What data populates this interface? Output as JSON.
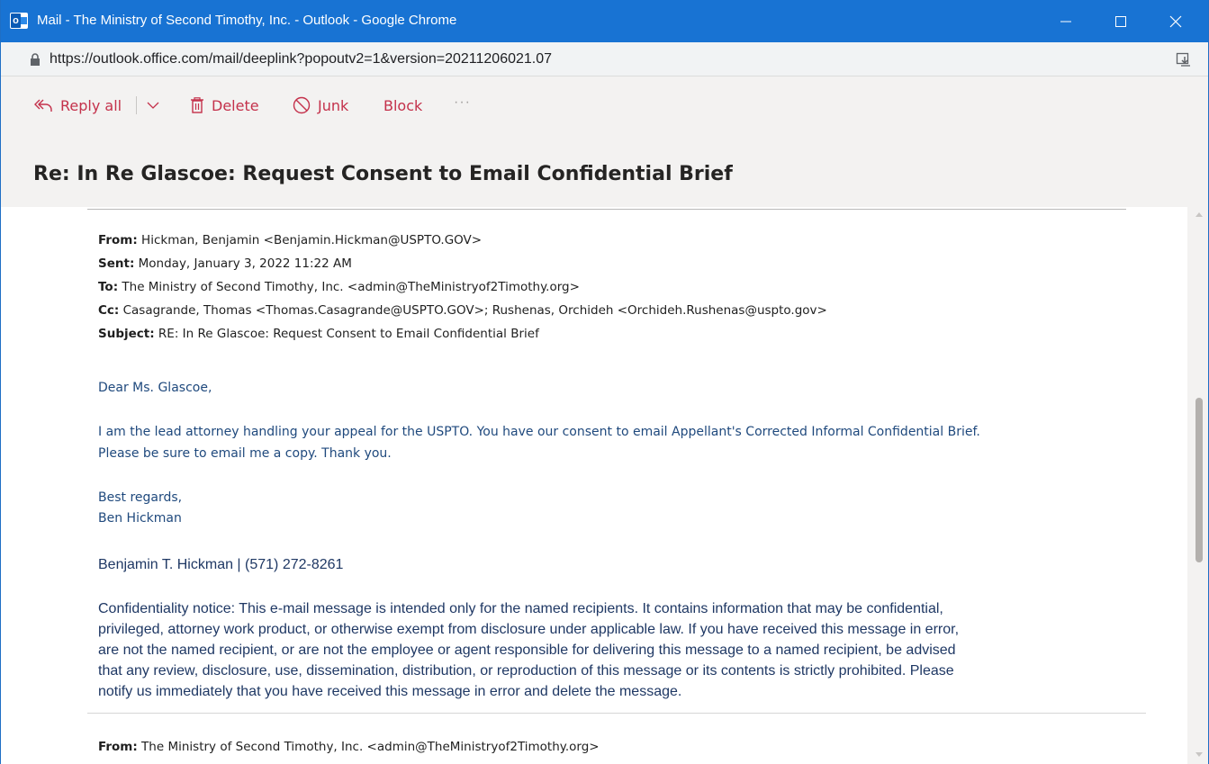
{
  "window": {
    "title": "Mail - The Ministry of Second Timothy, Inc. - Outlook - Google Chrome"
  },
  "address": {
    "url": "https://outlook.office.com/mail/deeplink?popoutv2=1&version=20211206021.07"
  },
  "toolbar": {
    "reply_all": "Reply all",
    "delete": "Delete",
    "junk": "Junk",
    "block": "Block",
    "more": "···"
  },
  "message": {
    "subject": "Re: In Re Glascoe: Request Consent to Email Confidential Brief",
    "quoted_header": {
      "from_label": "From:",
      "from_value": " Hickman, Benjamin <Benjamin.Hickman@USPTO.GOV>",
      "sent_label": "Sent:",
      "sent_value": " Monday, January 3, 2022 11:22 AM",
      "to_label": "To:",
      "to_value": " The Ministry of Second Timothy, Inc. <admin@TheMinistryof2Timothy.org>",
      "cc_label": "Cc:",
      "cc_value": " Casagrande, Thomas <Thomas.Casagrande@USPTO.GOV>; Rushenas, Orchideh <Orchideh.Rushenas@uspto.gov>",
      "subject_label": "Subject:",
      "subject_value": " RE: In Re Glascoe: Request Consent to Email Confidential Brief"
    },
    "greeting": "Dear Ms. Glascoe,",
    "body_line1": "I am the lead attorney handling your appeal for the USPTO. You have our consent to email Appellant's Corrected Informal Confidential Brief.",
    "body_line2": "Please be sure to email me a copy. Thank you.",
    "closing1": "Best regards,",
    "closing2": "Ben Hickman",
    "signature": "Benjamin T. Hickman | (571) 272-8261",
    "confidentiality": [
      "Confidentiality notice: This e-mail message is intended only for the named recipients. It contains information that may be confidential,",
      "privileged, attorney work product, or otherwise exempt from disclosure under applicable law. If you have received this message in error,",
      "are not the named recipient, or are not the employee or agent responsible for delivering this message to a named recipient, be advised",
      "that any review, disclosure, use, dissemination, distribution, or reproduction of this message or its contents is strictly prohibited. Please",
      "notify us immediately that you have received this message in error and delete the message."
    ],
    "next_from_label": "From:",
    "next_from_value": " The Ministry of Second Timothy, Inc. <admin@TheMinistryof2Timothy.org>"
  },
  "colors": {
    "titlebar": "#1873d3",
    "toolbar_accent": "#c4314b",
    "body_blue": "#1f497d"
  }
}
